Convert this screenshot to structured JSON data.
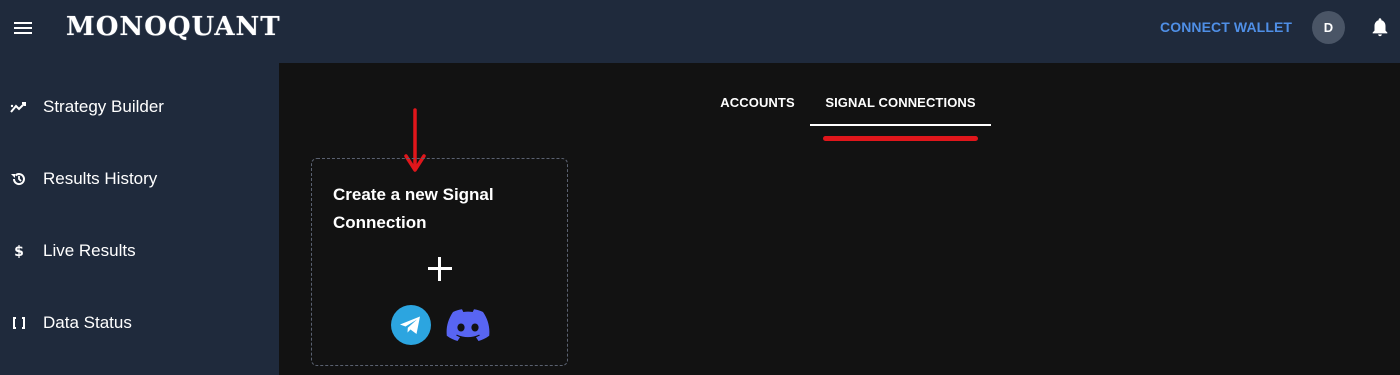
{
  "app": {
    "logo_text": "MONOQUANT"
  },
  "header": {
    "menu_icon": "hamburger-menu-icon",
    "connect_wallet_label": "CONNECT WALLET",
    "avatar_initial": "D",
    "notification_icon": "bell-icon"
  },
  "sidebar": {
    "items": [
      {
        "label": "Strategy Builder",
        "icon": "chart-line-icon"
      },
      {
        "label": "Results History",
        "icon": "history-icon"
      },
      {
        "label": "Live Results",
        "icon": "dollar-icon"
      },
      {
        "label": "Data Status",
        "icon": "brackets-icon"
      }
    ]
  },
  "tabs": [
    {
      "label": "ACCOUNTS",
      "active": false
    },
    {
      "label": "SIGNAL CONNECTIONS",
      "active": true
    }
  ],
  "card": {
    "title": "Create a new Signal Connection",
    "plus_icon": "plus-icon",
    "integrations": [
      "telegram-icon",
      "discord-icon"
    ]
  },
  "annotations": {
    "arrow_color": "#e0161b",
    "underline_color": "#e0161b"
  },
  "colors": {
    "header_bg": "#1f2a3c",
    "content_bg": "#121212",
    "accent_link": "#4f8fe6",
    "telegram": "#2ca5e0",
    "discord": "#5865f2"
  }
}
